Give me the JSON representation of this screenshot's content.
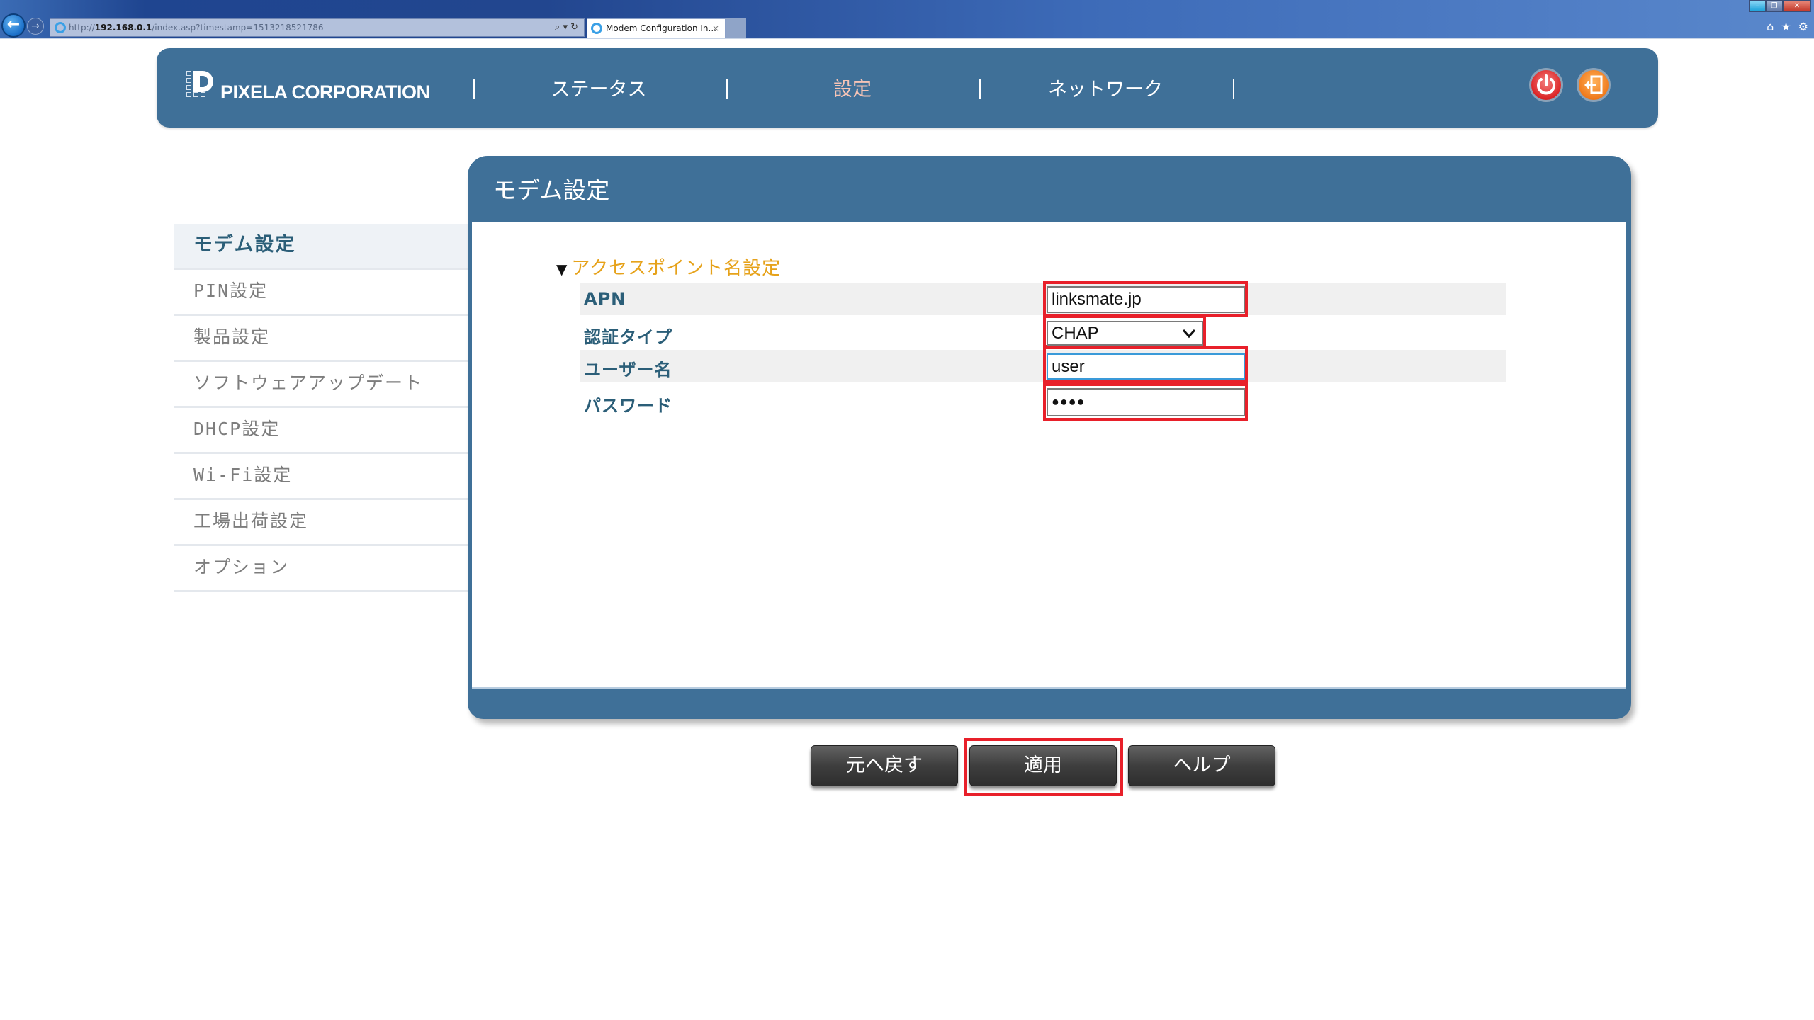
{
  "browser": {
    "url_prefix": "http://",
    "url_host": "192.168.0.1",
    "url_path": "/index.asp?timestamp=1513218521786",
    "tab_title": "Modem Configuration In...",
    "tab_close": "×",
    "search_refresh": "⌕ ▾ ↻",
    "back": "←",
    "forward": "→",
    "win_min": "–",
    "win_max": "❐",
    "win_close": "✕",
    "home": "⌂",
    "favorites": "★",
    "tools": "⚙"
  },
  "header": {
    "brand": "PIXELA CORPORATION",
    "nav": [
      {
        "label": "ステータス",
        "active": false
      },
      {
        "label": "設定",
        "active": true
      },
      {
        "label": "ネットワーク",
        "active": false
      }
    ],
    "icons": [
      "power-icon",
      "logout-icon"
    ],
    "active_color": "#f6c4b6"
  },
  "sidebar": {
    "items": [
      {
        "label": "モデム設定",
        "active": true
      },
      {
        "label": "PIN設定"
      },
      {
        "label": "製品設定"
      },
      {
        "label": "ソフトウェアアップデート"
      },
      {
        "label": "DHCP設定"
      },
      {
        "label": "Wi-Fi設定"
      },
      {
        "label": "工場出荷設定"
      },
      {
        "label": "オプション"
      }
    ]
  },
  "panel": {
    "title": "モデム設定",
    "section": {
      "toggle": "▼",
      "title": "アクセスポイント名設定"
    },
    "fields": {
      "apn": {
        "label": "APN",
        "value": "linksmate.jp"
      },
      "auth_type": {
        "label": "認証タイプ",
        "value": "CHAP"
      },
      "username": {
        "label": "ユーザー名",
        "value": "user"
      },
      "password": {
        "label": "パスワード",
        "value": "●●●●"
      }
    }
  },
  "buttons": {
    "revert": "元へ戻す",
    "apply": "適用",
    "help": "ヘルプ"
  },
  "colors": {
    "brand_blue": "#3f7098",
    "section_orange": "#e6a21a",
    "highlight_red": "#e8202a",
    "label_teal": "#2b5e78"
  }
}
